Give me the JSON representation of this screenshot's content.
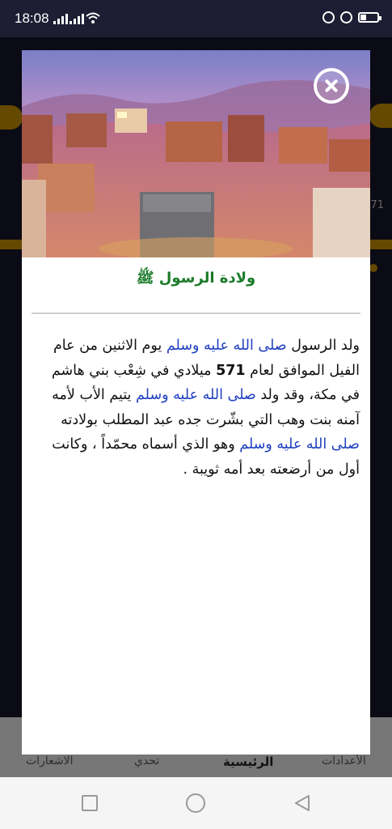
{
  "status_bar": {
    "time": "18:08"
  },
  "bottom_nav": {
    "tabs": [
      {
        "label": "الأعدادات"
      },
      {
        "label": "الرئيسية"
      },
      {
        "label": "تحدي"
      },
      {
        "label": "الاشعارات"
      }
    ]
  },
  "background": {
    "number": "71"
  },
  "modal": {
    "title": "ولادة الرسول ﷺ",
    "body": {
      "p1": "ولد الرسول ",
      "h1": "صلى الله عليه وسلم",
      "p2": " يوم الاثنين من عام الفيل الموافق لعام ",
      "year": "571",
      "p3": " ميلادي في شِعْب بني هاشم في مكة، وقد ولد ",
      "h2": "صلى الله عليه وسلم",
      "p4": " يتيم الأب لأمه آمنه بنت وهب التي بشّرت جده عبد المطلب بولادته ",
      "h3": "صلى الله عليه وسلم",
      "p5": " وهو الذي أسماه محمّداً ، وكانت أول من أرضعته بعد أمه ثويبة ."
    }
  },
  "colors": {
    "title_green": "#1b7b2a",
    "salawat_blue": "#1e3fbf",
    "accent_gold": "#b98600"
  }
}
